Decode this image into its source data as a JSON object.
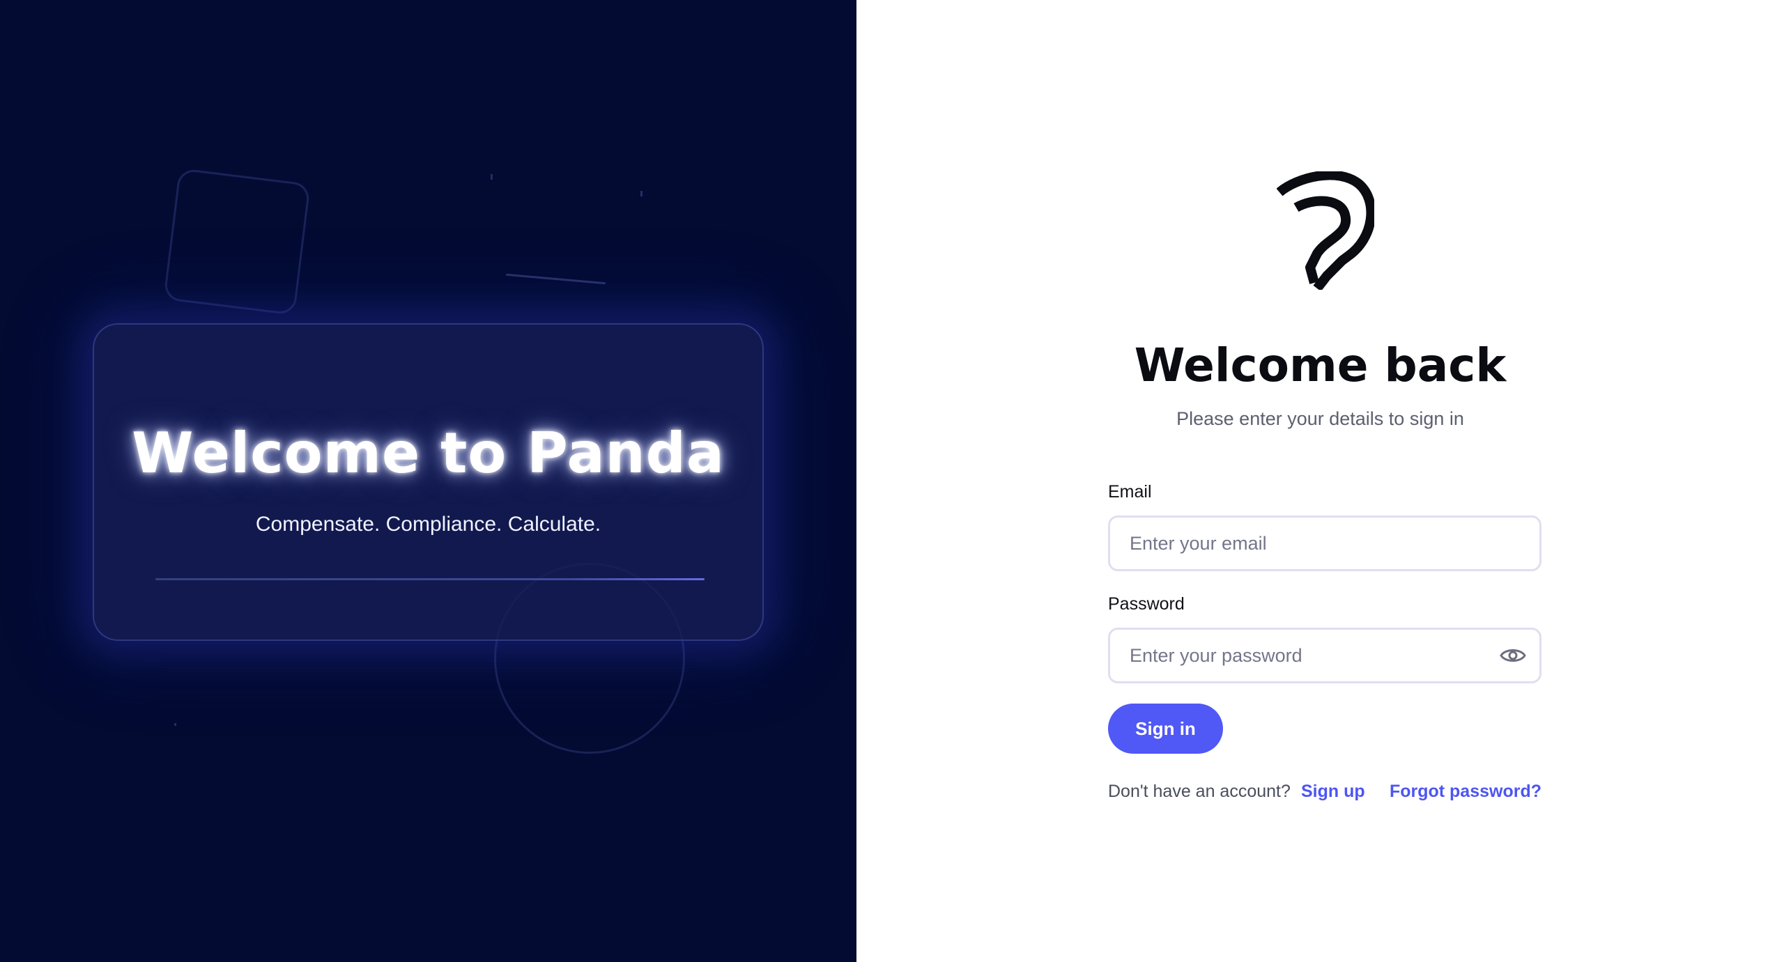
{
  "hero": {
    "title": "Welcome to Panda",
    "tagline": "Compensate. Compliance. Calculate."
  },
  "auth": {
    "logo_icon": "panda-p-logo-icon",
    "title": "Welcome back",
    "subtitle": "Please enter your details to sign in",
    "email": {
      "label": "Email",
      "placeholder": "Enter your email",
      "value": ""
    },
    "password": {
      "label": "Password",
      "placeholder": "Enter your password",
      "value": "",
      "toggle_icon": "eye-icon"
    },
    "signin_label": "Sign in",
    "no_account_text": "Don't have an account?",
    "signup_label": "Sign up",
    "forgot_label": "Forgot password?"
  },
  "colors": {
    "hero_bg": "#030b33",
    "accent": "#5058f5",
    "link": "#4c56f2",
    "input_border": "#dedff0"
  }
}
